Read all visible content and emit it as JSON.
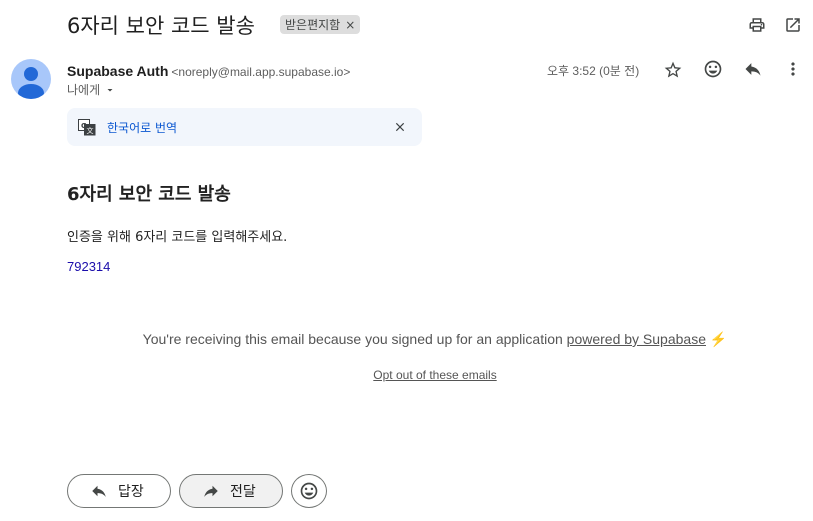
{
  "email": {
    "subject": "6자리 보안 코드 발송",
    "label": "받은편지함",
    "label_remove": "×",
    "sender_name": "Supabase Auth",
    "sender_email": "<noreply@mail.app.supabase.io>",
    "recipient": "나에게",
    "time": "오후 3:52 (0분 전)"
  },
  "translate": {
    "link": "한국어로 번역"
  },
  "body": {
    "heading": "6자리 보안 코드 발송",
    "instruction": "인증을 위해 6자리 코드를 입력해주세요.",
    "code": "792314",
    "footer_text": "You're receiving this email because you signed up for an application",
    "footer_link": "powered by Supabase",
    "bolt": "⚡",
    "optout": "Opt out of these emails"
  },
  "actions": {
    "reply": "답장",
    "forward": "전달"
  },
  "icons": [
    "print-icon",
    "open-in-new-icon",
    "star-icon",
    "emoji-icon",
    "reply-icon",
    "more-vert-icon",
    "translate-icon",
    "close-icon",
    "forward-icon"
  ],
  "colors": {
    "link": "#0b57d0",
    "code": "#1a0dab",
    "translate_bg": "#f2f6fc",
    "avatar": "#a8c7fa"
  }
}
